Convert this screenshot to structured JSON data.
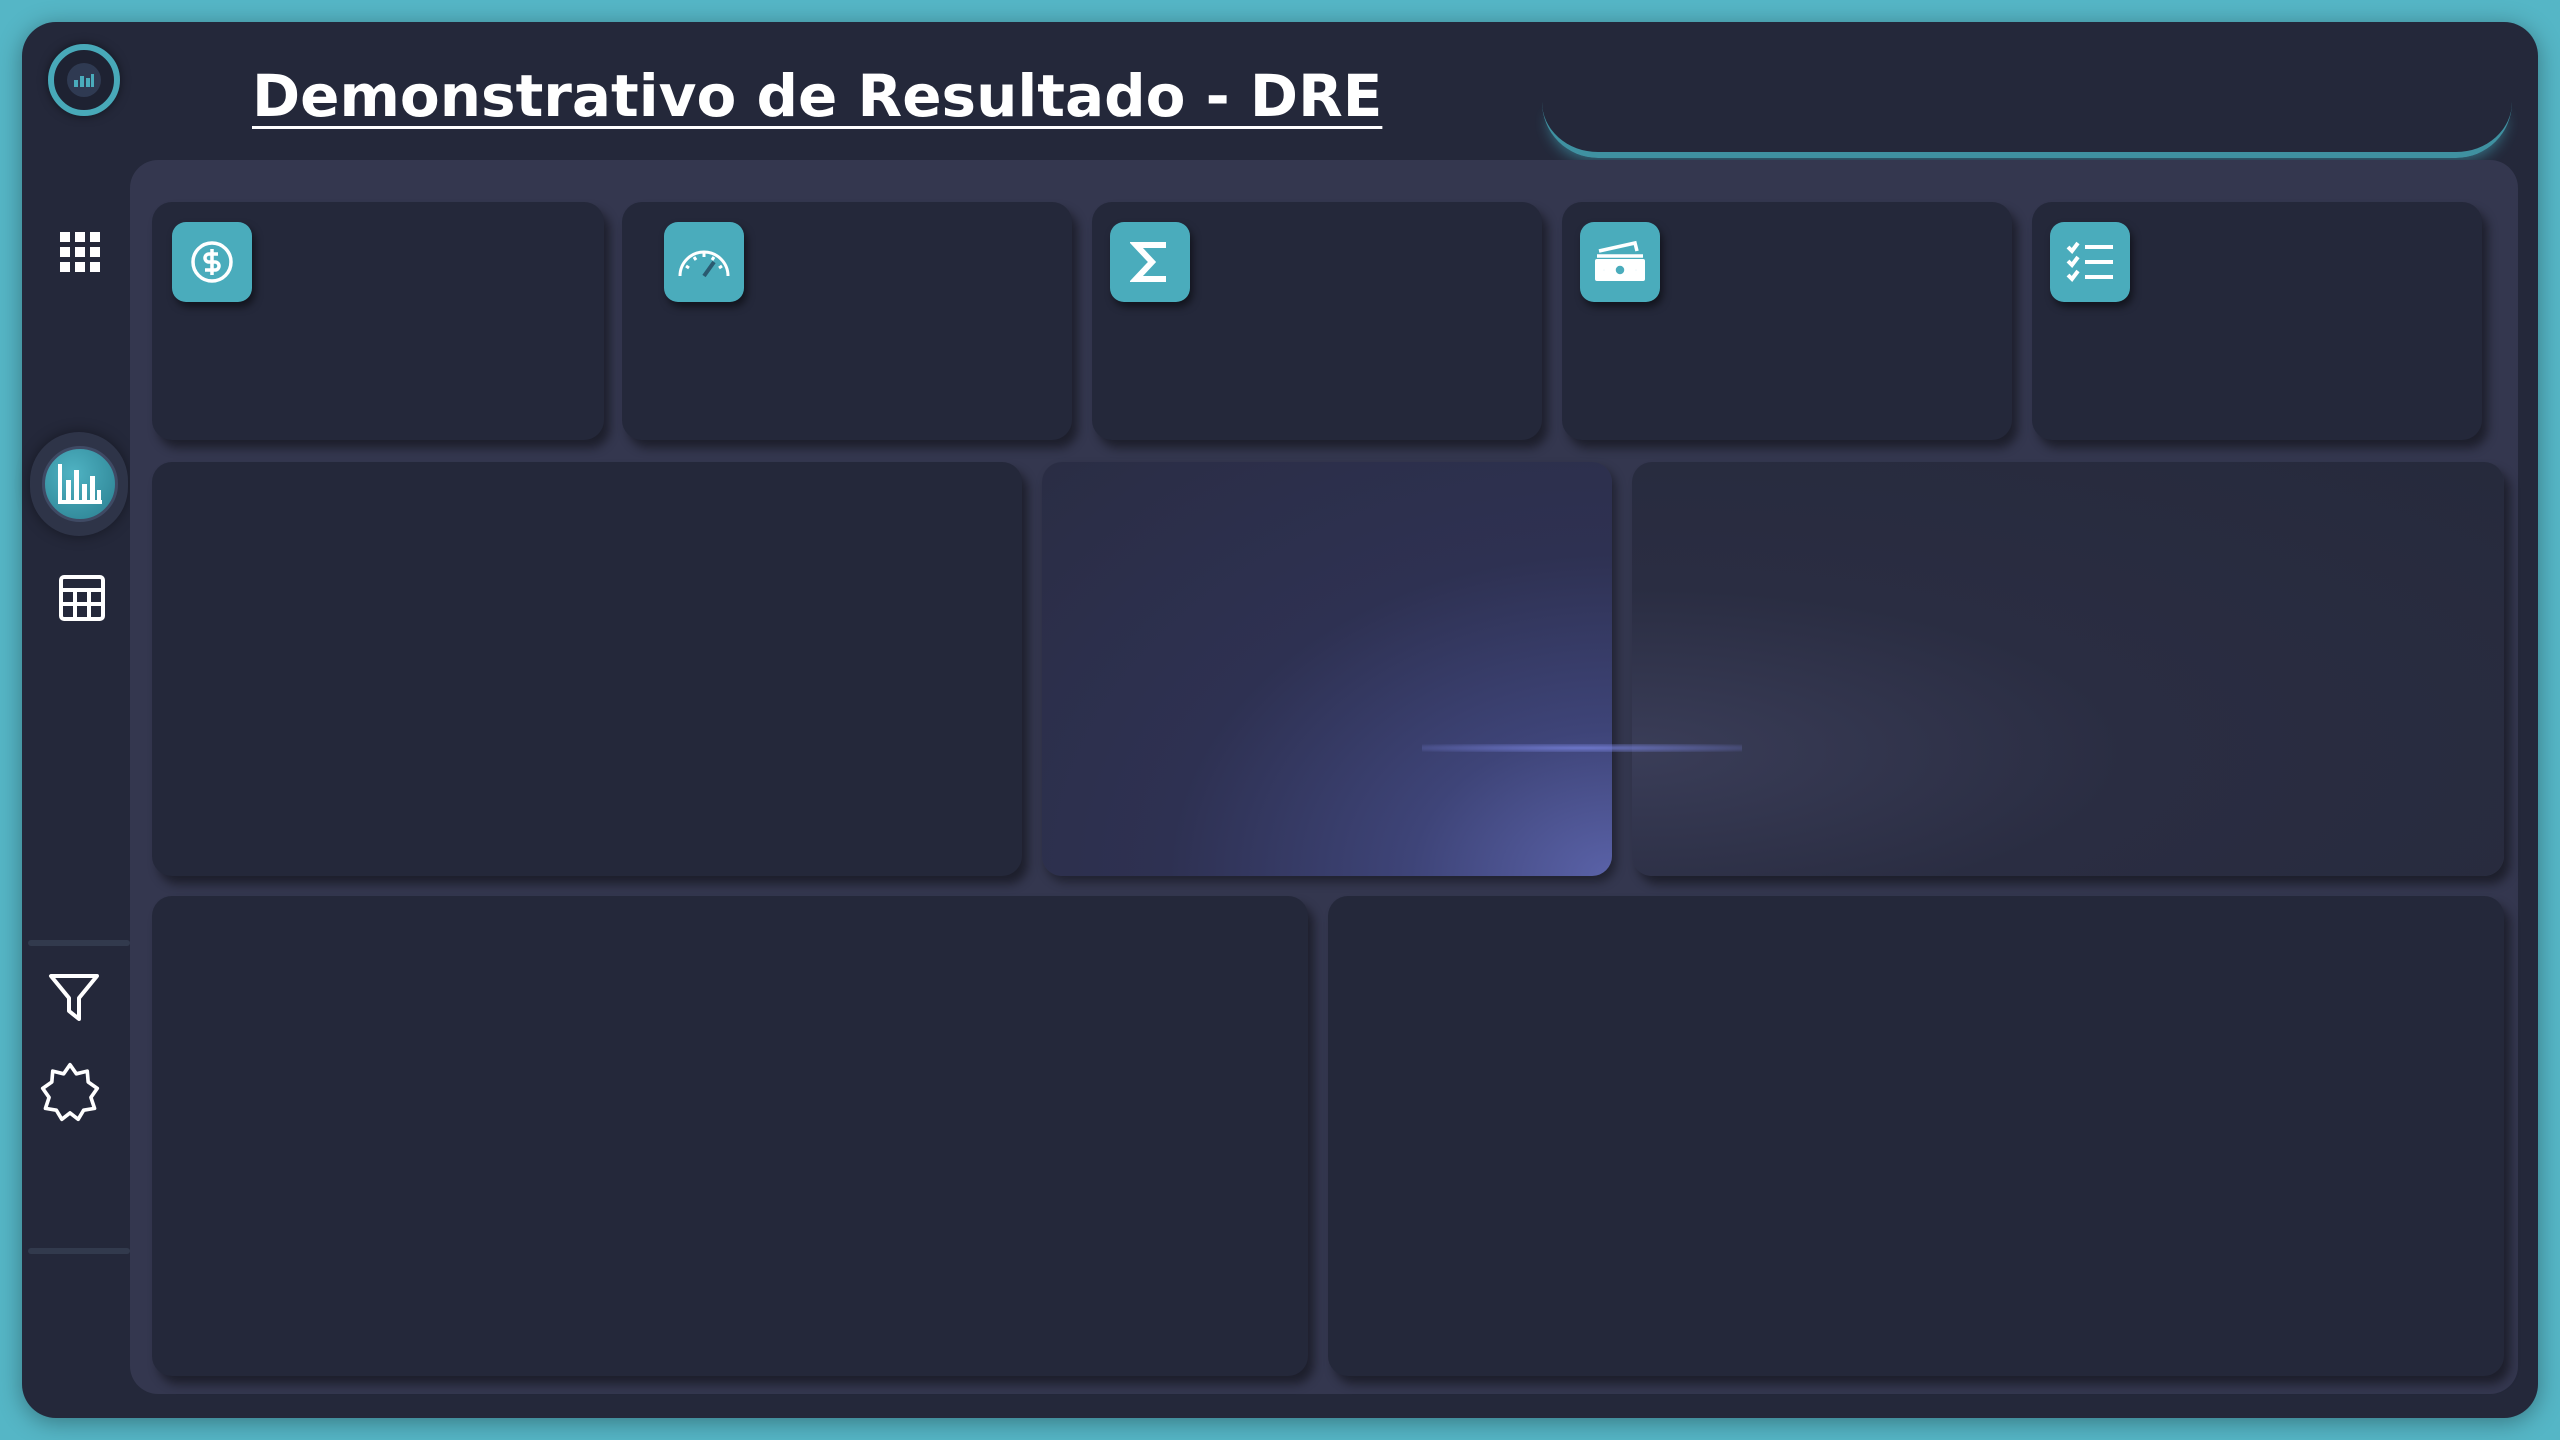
{
  "header": {
    "title": "Demonstrativo de Resultado - DRE"
  },
  "sidebar": {
    "items": [
      {
        "icon": "apps-grid-icon"
      },
      {
        "icon": "bar-chart-icon",
        "active": true
      },
      {
        "icon": "calculator-table-icon"
      },
      {
        "icon": "filter-icon"
      },
      {
        "icon": "theme-toggle-icon"
      }
    ]
  },
  "kpi_cards": [
    {
      "icon": "dollar-circle-icon"
    },
    {
      "icon": "speedometer-icon"
    },
    {
      "icon": "sigma-icon"
    },
    {
      "icon": "cash-bills-icon"
    },
    {
      "icon": "checklist-icon"
    }
  ],
  "colors": {
    "background": "#55b6c6",
    "app": "#24283a",
    "panel": "#34374f",
    "accent": "#4aacbc",
    "glow": "#5a62a8"
  }
}
